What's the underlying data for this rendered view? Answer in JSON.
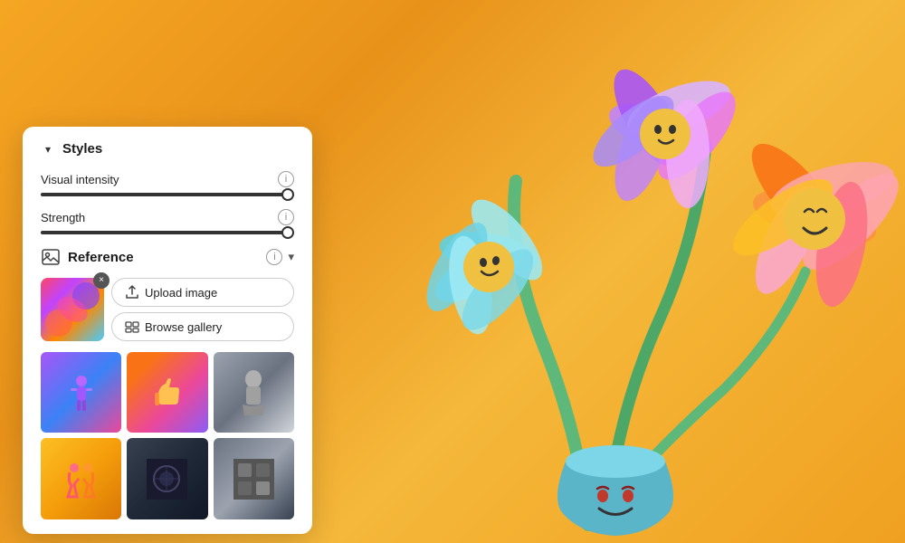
{
  "background": {
    "gradient_start": "#f5a623",
    "gradient_end": "#e8921a"
  },
  "panel": {
    "title": "Styles",
    "collapse_icon": "▾",
    "visual_intensity": {
      "label": "Visual intensity",
      "value": 100,
      "info_label": "i"
    },
    "strength": {
      "label": "Strength",
      "value": 100,
      "info_label": "i"
    },
    "reference": {
      "title": "Reference",
      "info_label": "i",
      "chevron": "▾",
      "upload_button": "Upload image",
      "browse_button": "Browse gallery",
      "close_label": "×"
    }
  },
  "gallery": {
    "thumbnails": [
      {
        "id": 0,
        "class": "thumb-0",
        "label": "purple-neon-figure"
      },
      {
        "id": 1,
        "class": "thumb-1",
        "label": "thumbs-up-colorful"
      },
      {
        "id": 2,
        "class": "thumb-2",
        "label": "sculpture-grayscale"
      },
      {
        "id": 3,
        "class": "thumb-3",
        "label": "warm-texture"
      },
      {
        "id": 4,
        "class": "thumb-4",
        "label": "dark-abstract"
      },
      {
        "id": 5,
        "class": "thumb-5",
        "label": "gray-abstract"
      }
    ]
  }
}
